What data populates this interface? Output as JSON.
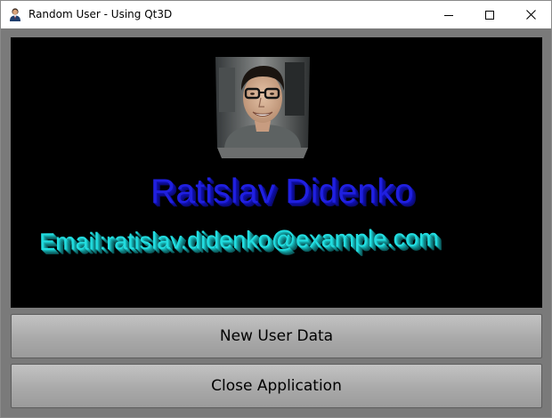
{
  "window": {
    "title": "Random User - Using Qt3D",
    "icon": "user-avatar-icon",
    "controls": [
      "minimize-icon",
      "maximize-icon",
      "close-icon"
    ]
  },
  "scene": {
    "background": "#000000",
    "avatar": "profile-photo",
    "name": "Ratislav Didenko",
    "name_color": "#2020e0",
    "email": "Email:ratislav.didenko@example.com",
    "email_color": "#22dde0"
  },
  "buttons": {
    "new_user": "New User Data",
    "close_app": "Close Application"
  }
}
